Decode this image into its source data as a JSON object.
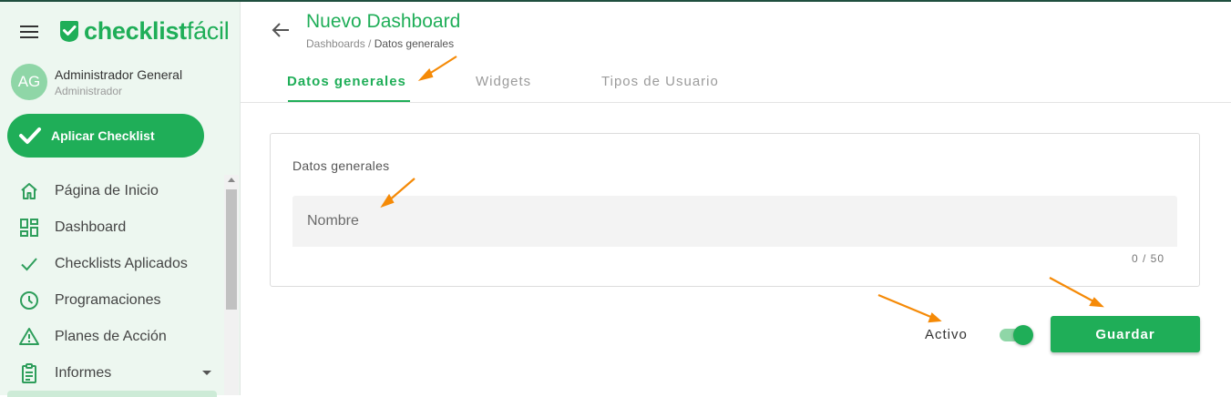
{
  "colors": {
    "brand": "#1fae58",
    "annotation_arrow": "#f58a07",
    "sidebar_bg": "#edf7f0"
  },
  "sidebar": {
    "logo": {
      "bold": "checklist",
      "light": "fácil"
    },
    "user": {
      "initials": "AG",
      "name": "Administrador General",
      "role": "Administrador"
    },
    "apply_button": {
      "label": "Aplicar Checklist",
      "icon": "check-icon"
    },
    "items": [
      {
        "label": "Página de Inicio",
        "icon": "home-icon"
      },
      {
        "label": "Dashboard",
        "icon": "dashboard-icon"
      },
      {
        "label": "Checklists Aplicados",
        "icon": "check-icon"
      },
      {
        "label": "Programaciones",
        "icon": "clock-icon"
      },
      {
        "label": "Planes de Acción",
        "icon": "warning-icon"
      },
      {
        "label": "Informes",
        "icon": "clipboard-icon",
        "has_submenu": true
      }
    ]
  },
  "header": {
    "title": "Nuevo Dashboard",
    "breadcrumb": {
      "parent": "Dashboards /",
      "current": "Datos generales"
    }
  },
  "tabs": [
    {
      "label": "Datos generales",
      "active": true
    },
    {
      "label": "Widgets",
      "active": false
    },
    {
      "label": "Tipos de Usuario",
      "active": false
    }
  ],
  "form": {
    "section_title": "Datos generales",
    "name_field": {
      "placeholder": "Nombre",
      "value": "",
      "counter": "0 / 50"
    }
  },
  "footer": {
    "active_label": "Activo",
    "active_toggle_on": true,
    "save_label": "Guardar"
  }
}
